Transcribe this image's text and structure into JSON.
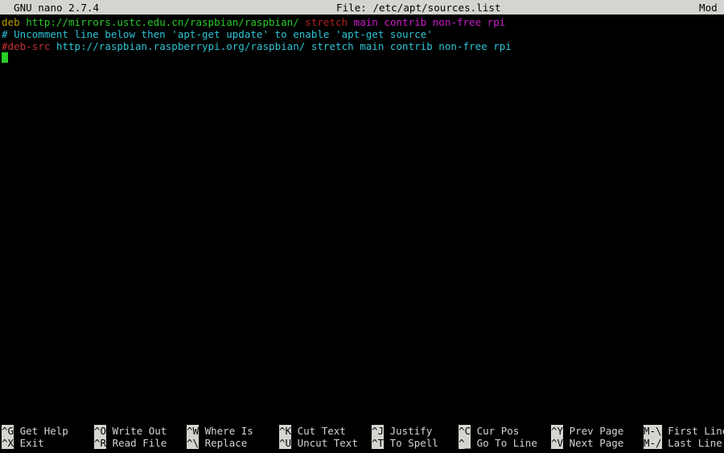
{
  "titlebar": {
    "version": "GNU nano 2.7.4",
    "file_label": "File: /etc/apt/sources.list",
    "modified_flag": "Mod"
  },
  "editor": {
    "lines": [
      {
        "segments": [
          {
            "text": "deb ",
            "color": "#b8a000"
          },
          {
            "text": "http://mirrors.ustc.edu.cn/raspbian/raspbian/ ",
            "color": "#27cc27"
          },
          {
            "text": "stretch ",
            "color": "#b42020"
          },
          {
            "text": "main contrib non-free rpi",
            "color": "#cc1bcc"
          }
        ],
        "plain": "deb http://mirrors.ustc.edu.cn/raspbian/raspbian/ stretch main contrib non-free rpi"
      },
      {
        "segments": [
          {
            "text": "# Uncomment line below then 'apt-get update' to enable 'apt-get source'",
            "color": "#2ec5d6"
          }
        ],
        "plain": "# Uncomment line below then 'apt-get update' to enable 'apt-get source'"
      },
      {
        "segments": [
          {
            "text": "#deb-src",
            "color": "#c43232"
          },
          {
            "text": " http://raspbian.raspberrypi.org/raspbian/ stretch main contrib non-free rpi",
            "color": "#2ec5d6"
          }
        ],
        "plain": "#deb-src http://raspbian.raspberrypi.org/raspbian/ stretch main contrib non-free rpi"
      }
    ],
    "line1_part_keyword": "deb ",
    "line1_part_url": "http://mirrors.ustc.edu.cn/raspbian/raspbian/ ",
    "line1_part_dist": "stretch ",
    "line1_part_components": "main contrib non-free rpi",
    "line2_comment": "# Uncomment line below then 'apt-get update' to enable 'apt-get source'",
    "line3_part_srcdeb": "#deb-src",
    "line3_part_rest": " http://raspbian.raspberrypi.org/raspbian/ stretch main contrib non-free rpi",
    "cursor": {
      "line": 4,
      "column": 1
    }
  },
  "help": {
    "shortcuts": [
      {
        "key": "^G",
        "label": " Get Help",
        "row": 0,
        "col": 0
      },
      {
        "key": "^X",
        "label": " Exit",
        "row": 1,
        "col": 0
      },
      {
        "key": "^O",
        "label": " Write Out",
        "row": 0,
        "col": 1
      },
      {
        "key": "^R",
        "label": " Read File",
        "row": 1,
        "col": 1
      },
      {
        "key": "^W",
        "label": " Where Is",
        "row": 0,
        "col": 2
      },
      {
        "key": "^\\",
        "label": " Replace",
        "row": 1,
        "col": 2
      },
      {
        "key": "^K",
        "label": " Cut Text",
        "row": 0,
        "col": 3
      },
      {
        "key": "^U",
        "label": " Uncut Text",
        "row": 1,
        "col": 3
      },
      {
        "key": "^J",
        "label": " Justify",
        "row": 0,
        "col": 4
      },
      {
        "key": "^T",
        "label": " To Spell",
        "row": 1,
        "col": 4
      },
      {
        "key": "^C",
        "label": " Cur Pos",
        "row": 0,
        "col": 5
      },
      {
        "key": "^_",
        "label": " Go To Line",
        "row": 1,
        "col": 5
      },
      {
        "key": "^Y",
        "label": " Prev Page",
        "row": 0,
        "col": 6
      },
      {
        "key": "^V",
        "label": " Next Page",
        "row": 1,
        "col": 6
      },
      {
        "key": "M-\\",
        "label": " First Line",
        "row": 0,
        "col": 7
      },
      {
        "key": "M-/",
        "label": " Last Line",
        "row": 1,
        "col": 7
      }
    ]
  }
}
